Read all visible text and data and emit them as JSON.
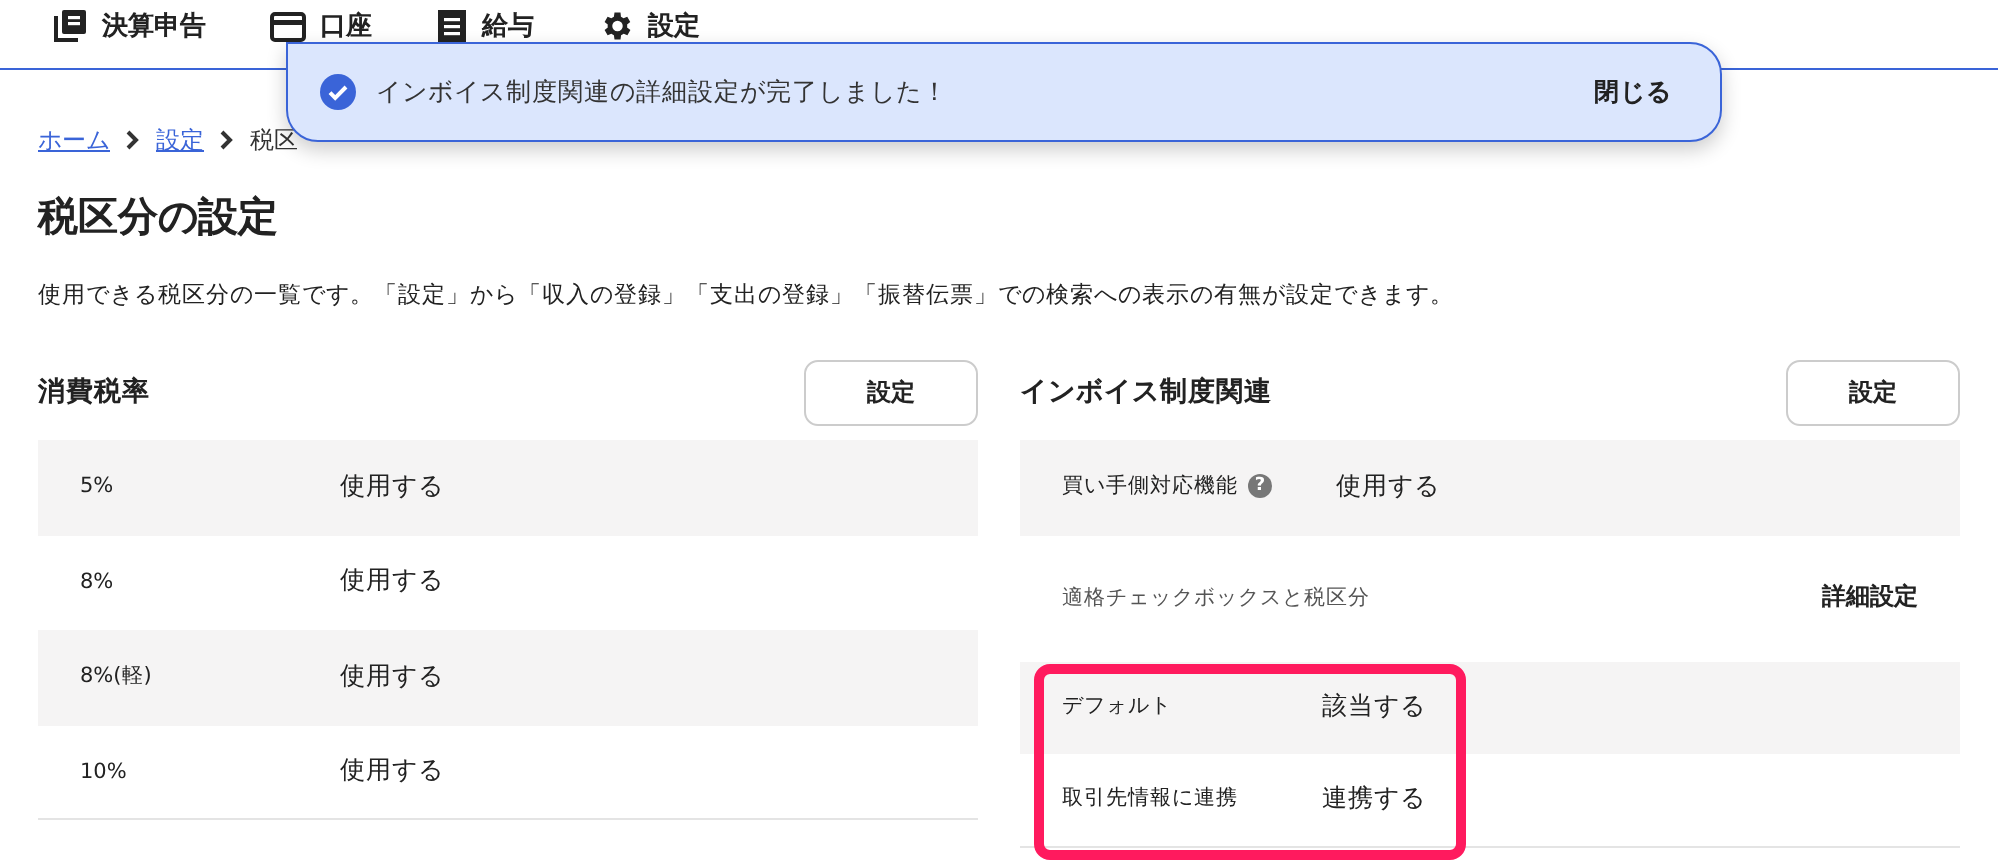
{
  "nav": [
    {
      "kind": "book",
      "label": "決算申告"
    },
    {
      "kind": "card",
      "label": "口座"
    },
    {
      "kind": "document",
      "label": "給与"
    },
    {
      "kind": "gear",
      "label": "設定"
    }
  ],
  "toast": {
    "message": "インボイス制度関連の詳細設定が完了しました！",
    "close": "閉じる"
  },
  "breadcrumb": {
    "links": [
      "ホーム",
      "設定"
    ],
    "current": "税区"
  },
  "title": "税区分の設定",
  "description": "使用できる税区分の一覧です。「設定」から「収入の登録」「支出の登録」「振替伝票」での検索への表示の有無が設定できます。",
  "tax_rates": {
    "heading": "消費税率",
    "button": "設定",
    "rows": [
      {
        "rate": "5%",
        "status": "使用する"
      },
      {
        "rate": "8%",
        "status": "使用する"
      },
      {
        "rate": "8%(軽)",
        "status": "使用する"
      },
      {
        "rate": "10%",
        "status": "使用する"
      }
    ]
  },
  "invoice": {
    "heading": "インボイス制度関連",
    "button": "設定",
    "feature": {
      "label": "買い手側対応機能",
      "help": "?",
      "value": "使用する"
    },
    "section": {
      "label": "適格チェックボックスと税区分",
      "link": "詳細設定"
    },
    "rows_highlighted": true,
    "rows": [
      {
        "label": "デフォルト",
        "value": "該当する"
      },
      {
        "label": "取引先情報に連携",
        "value": "連携する"
      }
    ]
  }
}
